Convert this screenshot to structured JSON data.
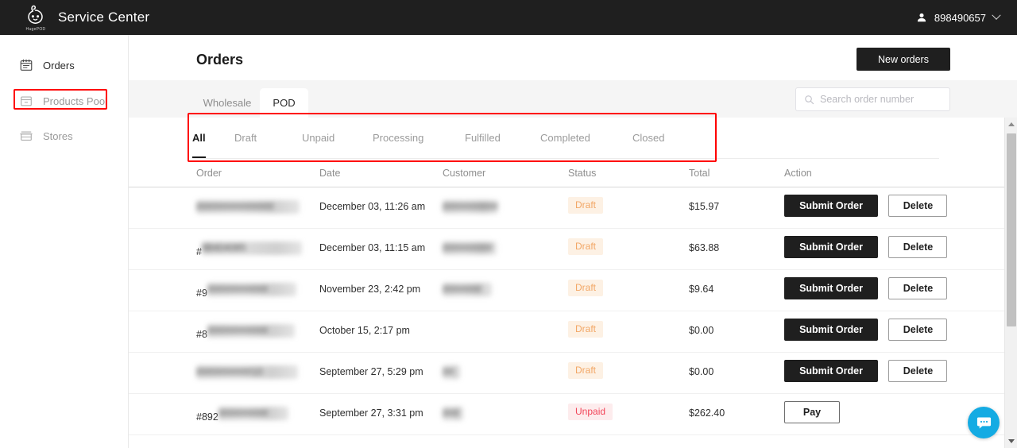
{
  "topbar": {
    "logo_name": "hugepod-logo-icon",
    "logo_sub": "HugePOD",
    "title": "Service Center",
    "account_id": "898490657"
  },
  "sidebar": {
    "items": [
      {
        "label": "Orders",
        "icon": "calendar-icon",
        "active": true
      },
      {
        "label": "Products Pool",
        "icon": "box-icon",
        "active": false
      },
      {
        "label": "Stores",
        "icon": "store-icon",
        "active": false
      }
    ]
  },
  "header": {
    "title": "Orders",
    "new_orders_label": "New orders"
  },
  "channel_tabs": [
    {
      "label": "Wholesale",
      "active": false
    },
    {
      "label": "POD",
      "active": true
    }
  ],
  "search": {
    "placeholder": "Search order number",
    "value": "",
    "icon": "search-icon"
  },
  "filter_tabs": [
    {
      "label": "All",
      "active": true
    },
    {
      "label": "Draft",
      "active": false
    },
    {
      "label": "Unpaid",
      "active": false
    },
    {
      "label": "Processing",
      "active": false
    },
    {
      "label": "Fulfilled",
      "active": false
    },
    {
      "label": "Completed",
      "active": false
    },
    {
      "label": "Closed",
      "active": false
    }
  ],
  "table": {
    "columns": [
      "Order",
      "Date",
      "Customer",
      "Status",
      "Total",
      "Action"
    ],
    "rows": [
      {
        "order_prefix": "",
        "order_redacted": true,
        "order_text": "##############",
        "date": "December 03, 11:26 am",
        "customer_redacted": true,
        "customer_text": "##########",
        "status": "Draft",
        "status_kind": "draft",
        "total": "$15.97",
        "actions": [
          {
            "label": "Submit Order",
            "kind": "dark"
          },
          {
            "label": "Delete",
            "kind": "light"
          }
        ]
      },
      {
        "order_prefix": "#",
        "order_redacted": true,
        "order_text": "    98404085",
        "date": "December 03, 11:15 am",
        "customer_redacted": true,
        "customer_text": "#########",
        "status": "Draft",
        "status_kind": "draft",
        "total": "$63.88",
        "actions": [
          {
            "label": "Submit Order",
            "kind": "dark"
          },
          {
            "label": "Delete",
            "kind": "light"
          }
        ]
      },
      {
        "order_prefix": "#9",
        "order_redacted": true,
        "order_text": "###########",
        "date": "November 23, 2:42 pm",
        "customer_redacted": true,
        "customer_text": "#######",
        "status": "Draft",
        "status_kind": "draft",
        "total": "$9.64",
        "actions": [
          {
            "label": "Submit Order",
            "kind": "dark"
          },
          {
            "label": "Delete",
            "kind": "light"
          }
        ]
      },
      {
        "order_prefix": "#8",
        "order_redacted": true,
        "order_text": "###########",
        "date": "October 15, 2:17 pm",
        "customer_redacted": false,
        "customer_text": "",
        "status": "Draft",
        "status_kind": "draft",
        "total": "$0.00",
        "actions": [
          {
            "label": "Submit Order",
            "kind": "dark"
          },
          {
            "label": "Delete",
            "kind": "light"
          }
        ]
      },
      {
        "order_prefix": "",
        "order_redacted": true,
        "order_text": "##########10",
        "date": "September 27, 5:29 pm",
        "customer_redacted": true,
        "customer_text": "##",
        "status": "Draft",
        "status_kind": "draft",
        "total": "$0.00",
        "actions": [
          {
            "label": "Submit Order",
            "kind": "dark"
          },
          {
            "label": "Delete",
            "kind": "light"
          }
        ]
      },
      {
        "order_prefix": "#892",
        "order_redacted": true,
        "order_text": "#########",
        "date": "September 27, 3:31 pm",
        "customer_redacted": true,
        "customer_text": "###",
        "status": "Unpaid",
        "status_kind": "unpaid",
        "total": "$262.40",
        "actions": [
          {
            "label": "Pay",
            "kind": "pay"
          }
        ]
      }
    ]
  },
  "chat": {
    "icon": "chat-bubble-icon"
  },
  "scrollbar": {
    "up_icon": "scroll-up-arrow-icon",
    "down_icon": "scroll-down-arrow-icon"
  },
  "colors": {
    "topbar_bg": "#1f1f1f",
    "accent_dark": "#1f1f1f",
    "highlight_box": "#ff0000",
    "badge_draft_text": "#f2a766",
    "badge_draft_bg": "#fdf1e4",
    "badge_unpaid_text": "#f2465a",
    "badge_unpaid_bg": "#fdeced",
    "chat_blue": "#14abe3"
  }
}
